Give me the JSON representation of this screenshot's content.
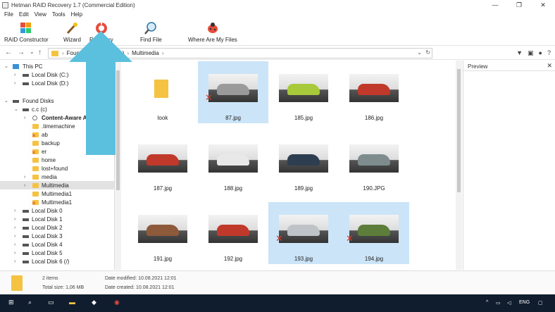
{
  "window": {
    "title": "Hetman RAID Recovery 1.7 (Commercial Edition)",
    "controls": [
      "—",
      "❐",
      "✕"
    ]
  },
  "menu": [
    "File",
    "Edit",
    "View",
    "Tools",
    "Help"
  ],
  "toolbar": {
    "raid_constructor": "RAID Constructor",
    "wizard": "Wizard",
    "recovery": "Recovery",
    "find_file": "Find File",
    "where_are_my_files": "Where Are My Files"
  },
  "address": {
    "crumbs": [
      "Found Disks",
      "(c)",
      "Multimedia"
    ],
    "back": "←",
    "forward": "→",
    "history": "⌄",
    "up": "↑",
    "dropdown": "⌄",
    "refresh": "↻"
  },
  "tree": {
    "this_pc": "This PC",
    "local_c": "Local Disk (C:)",
    "local_d": "Local Disk (D:)",
    "found_disks": "Found Disks",
    "cc": "c.c (c)",
    "content_aware": "Content-Aware A",
    "timemachine": ".timemachine",
    "ab": "ab",
    "backup": "backup",
    "er": "er",
    "home": "home",
    "lost_found": "lost+found",
    "media": "media",
    "multimedia": "Multimedia",
    "multimedia1a": "Multimedia1",
    "multimedia1b": "Multimedia1",
    "disk0": "Local Disk 0",
    "disk1": "Local Disk 1",
    "disk2": "Local Disk 2",
    "disk3": "Local Disk 3",
    "disk4": "Local Disk 4",
    "disk5": "Local Disk 5",
    "disk6": "Local Disk 6 (/)"
  },
  "files": [
    {
      "name": "look",
      "type": "folder",
      "selected": false,
      "deleted": false
    },
    {
      "name": "87.jpg",
      "type": "image",
      "selected": true,
      "deleted": true,
      "color": "#9a9a9a"
    },
    {
      "name": "185.jpg",
      "type": "image",
      "selected": false,
      "deleted": false,
      "color": "#a8c93a"
    },
    {
      "name": "186.jpg",
      "type": "image",
      "selected": false,
      "deleted": false,
      "color": "#c0392b"
    },
    {
      "name": "187.jpg",
      "type": "image",
      "selected": false,
      "deleted": false,
      "color": "#c0392b"
    },
    {
      "name": "188.jpg",
      "type": "image",
      "selected": false,
      "deleted": false,
      "color": "#e8e8e8"
    },
    {
      "name": "189.jpg",
      "type": "image",
      "selected": false,
      "deleted": false,
      "color": "#2c3e50"
    },
    {
      "name": "190.JPG",
      "type": "image",
      "selected": false,
      "deleted": false,
      "color": "#7f8c8d"
    },
    {
      "name": "191.jpg",
      "type": "image",
      "selected": false,
      "deleted": false,
      "color": "#8e5a3c"
    },
    {
      "name": "192.jpg",
      "type": "image",
      "selected": false,
      "deleted": false,
      "color": "#c0392b"
    },
    {
      "name": "193.jpg",
      "type": "image",
      "selected": true,
      "deleted": true,
      "color": "#bdc3c7"
    },
    {
      "name": "194.jpg",
      "type": "image",
      "selected": true,
      "deleted": true,
      "color": "#5d7d3a"
    }
  ],
  "preview": {
    "title": "Preview",
    "close": "✕"
  },
  "status": {
    "items": "2 items",
    "total_size": "Total size: 1,06 MB",
    "modified": "Date modified: 10.08.2021 12:01",
    "created": "Date created: 10.08.2021 12:01"
  },
  "taskbar": {
    "lang": "ENG"
  },
  "colors": {
    "accent": "#5bc0de",
    "selection": "#cce4f7",
    "deleted": "#d23b2a",
    "folder": "#f5c242"
  }
}
